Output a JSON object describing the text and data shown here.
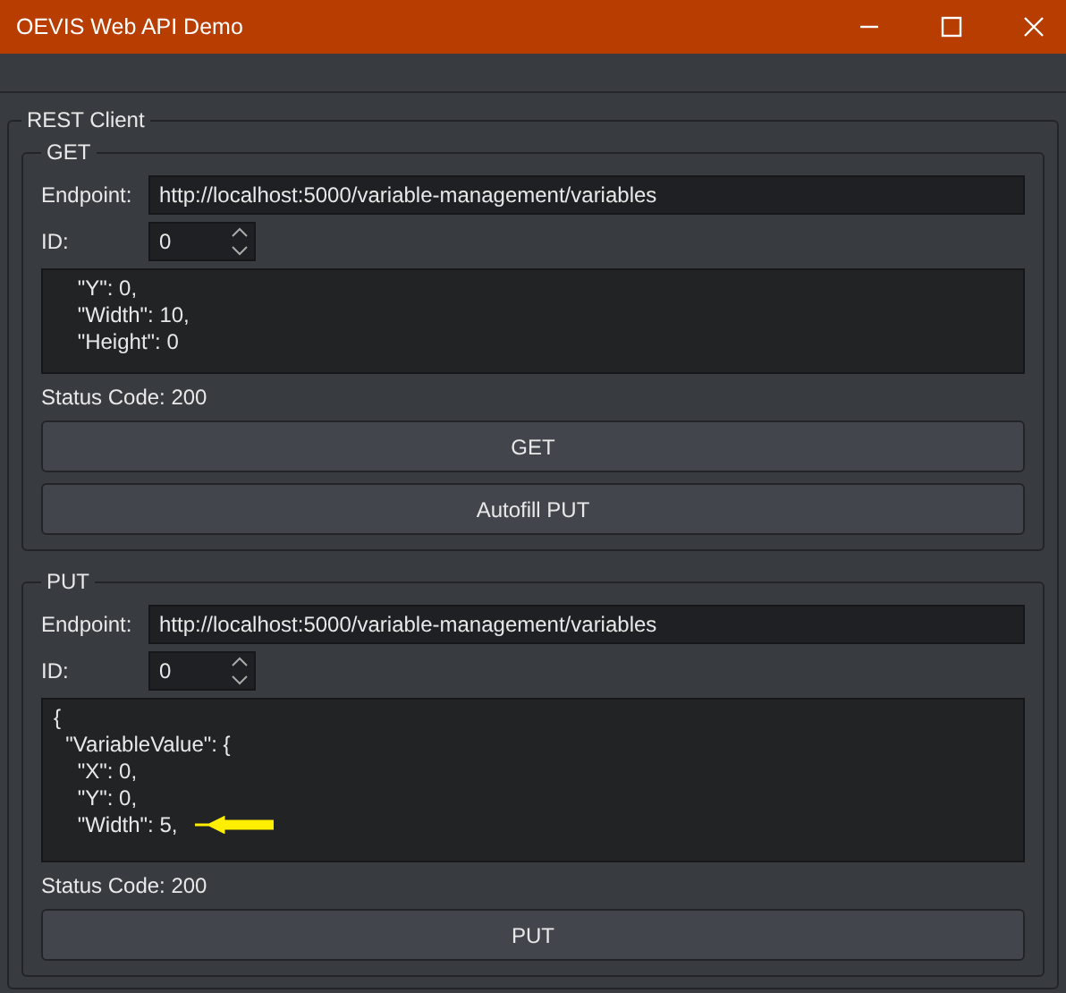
{
  "window": {
    "title": "OEVIS Web API Demo"
  },
  "group": {
    "title": "REST Client",
    "sections": [
      {
        "title": "GET",
        "endpoint_label": "Endpoint:",
        "endpoint": "http://localhost:5000/variable-management/variables",
        "id_label": "ID:",
        "id": "0",
        "body_lines": [
          {
            "text": "    \"Y\": 0,",
            "marked": false
          },
          {
            "text": "    \"Width\": 10,",
            "marked": false
          },
          {
            "text": "    \"Height\": 0",
            "marked": false
          }
        ],
        "status": "Status Code: 200",
        "buttons": [
          "GET",
          "Autofill PUT"
        ]
      },
      {
        "title": "PUT",
        "endpoint_label": "Endpoint:",
        "endpoint": "http://localhost:5000/variable-management/variables",
        "id_label": "ID:",
        "id": "0",
        "body_lines": [
          {
            "text": "{",
            "marked": false
          },
          {
            "text": "  \"VariableValue\": {",
            "marked": false
          },
          {
            "text": "    \"X\": 0,",
            "marked": false
          },
          {
            "text": "    \"Y\": 0,",
            "marked": false
          },
          {
            "text": "    \"Width\": 5,",
            "marked": true
          }
        ],
        "status": "Status Code: 200",
        "buttons": [
          "PUT"
        ]
      }
    ]
  }
}
